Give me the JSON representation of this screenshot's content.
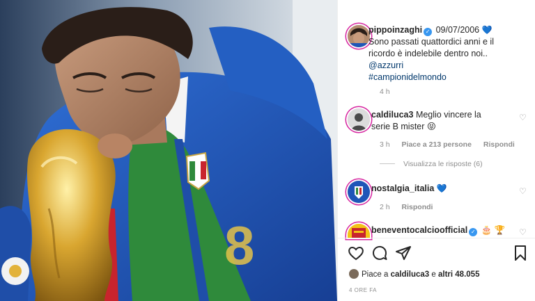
{
  "post": {
    "author": "pippoinzaghi",
    "date": "09/07/2006",
    "caption_line1": "Sono passati quattordici anni e il",
    "caption_line2": "ricordo è indelebile dentro noi..",
    "mention": "@azzurri",
    "hashtag": "#campionidelmondo",
    "caption_time": "4 h",
    "liked_by_prefix": "Piace a",
    "liked_by_user": "caldiluca3",
    "liked_by_middle": "e",
    "liked_by_count": "altri 48.055",
    "post_time": "4 ORE FA",
    "photo_number": "8"
  },
  "comments": [
    {
      "user": "caldiluca3",
      "text_line1": "Meglio vincere la",
      "text_line2": "serie B mister",
      "emoji": "😝",
      "time": "3 h",
      "likes": "Piace a 213 persone",
      "reply": "Rispondi",
      "view_replies": "Visualizza le risposte (6)"
    },
    {
      "user": "nostalgia_italia",
      "emoji": "💙",
      "time": "2 h",
      "reply": "Rispondi"
    },
    {
      "user": "beneventocalcioofficial",
      "emoji": "🎂 🏆"
    }
  ],
  "icons": {
    "like": "heart-outline-icon",
    "comment": "comment-icon",
    "share": "paper-plane-icon",
    "save": "bookmark-icon",
    "comment_like": "small-heart-icon",
    "verified": "verified-badge-icon"
  },
  "colors": {
    "accent_blue": "#3897f0",
    "jersey_blue": "#1f56b8",
    "trophy_gold": "#d8a82c",
    "flag_green": "#2f8a3b",
    "muted_text": "#8e8e8e"
  }
}
